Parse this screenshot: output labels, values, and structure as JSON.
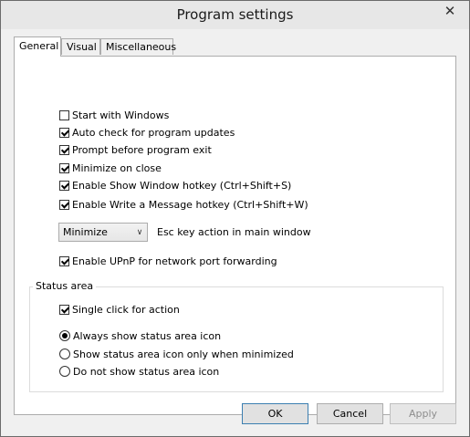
{
  "window": {
    "title": "Program settings"
  },
  "tabs": [
    {
      "label": "General"
    },
    {
      "label": "Visual"
    },
    {
      "label": "Miscellaneous"
    }
  ],
  "general": {
    "checkboxes": [
      {
        "label": "Start with Windows",
        "checked": false
      },
      {
        "label": "Auto check for program updates",
        "checked": true
      },
      {
        "label": "Prompt before program exit",
        "checked": true
      },
      {
        "label": "Minimize on close",
        "checked": true
      },
      {
        "label": "Enable Show Window hotkey (Ctrl+Shift+S)",
        "checked": true
      },
      {
        "label": "Enable Write a Message hotkey (Ctrl+Shift+W)",
        "checked": true
      }
    ],
    "esc_action": {
      "value": "Minimize",
      "label": "Esc key action in main window"
    },
    "upnp": {
      "label": "Enable UPnP for network port forwarding",
      "checked": true
    },
    "status_area": {
      "title": "Status area",
      "single_click": {
        "label": "Single click for action",
        "checked": true
      },
      "radios": [
        {
          "label": "Always show status area icon",
          "selected": true
        },
        {
          "label": "Show status area icon only when minimized",
          "selected": false
        },
        {
          "label": "Do not show status area icon",
          "selected": false
        }
      ]
    }
  },
  "buttons": {
    "ok": "OK",
    "cancel": "Cancel",
    "apply": "Apply"
  }
}
